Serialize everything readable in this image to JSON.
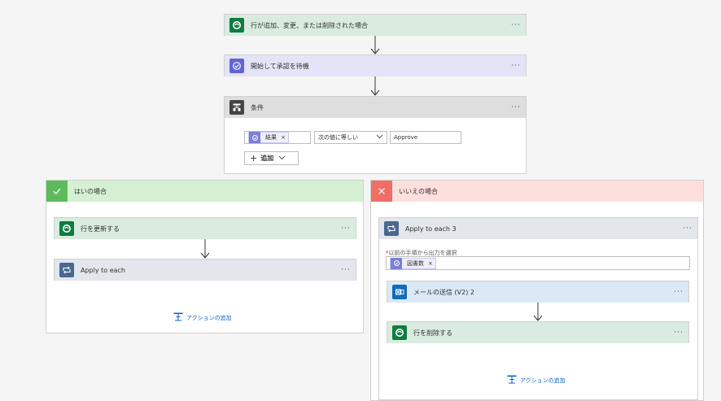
{
  "trigger": {
    "title": "行が追加、変更、または削除された場合",
    "menu": "···"
  },
  "approval": {
    "title": "開始して承認を待機",
    "menu": "···"
  },
  "condition": {
    "title": "条件",
    "menu": "···",
    "token": "結果",
    "token_remove": "×",
    "operator": "次の値に等しい",
    "value": "Approve",
    "add_label": "追加",
    "add_plus": "+",
    "add_chevron": "⌄"
  },
  "yes_branch": {
    "title": "はいの場合",
    "update_row": {
      "title": "行を更新する",
      "menu": "···"
    },
    "apply_each": {
      "title": "Apply to each",
      "menu": "···"
    },
    "add_action": "アクションの追加"
  },
  "no_branch": {
    "title": "いいえの場合",
    "apply_each3": {
      "title": "Apply to each 3",
      "menu": "···",
      "required_mark": "*",
      "select_label": "以前の手順から出力を選択",
      "token": "図書数",
      "token_remove": "×"
    },
    "send_mail": {
      "title": "メールの送信 (V2) 2",
      "menu": "···"
    },
    "delete_row": {
      "title": "行を削除する",
      "menu": "···"
    },
    "add_action": "アクションの追加"
  },
  "colors": {
    "dataverse": "#107c41",
    "dataverse_bg": "#d9ecdf",
    "approval": "#6264d7",
    "approval_bg": "#e4e4f8",
    "control": "#444444",
    "control_bg": "#dedede",
    "loop": "#486991",
    "loop_bg": "#e3e6ec",
    "yes_bg": "#d6f0d4",
    "yes_icon": "#5dbb5b",
    "no_bg": "#fde0de",
    "no_icon": "#f06e66",
    "outlook": "#0f6cbd",
    "outlook_bg": "#dbe9f7",
    "link": "#0b63c5"
  }
}
